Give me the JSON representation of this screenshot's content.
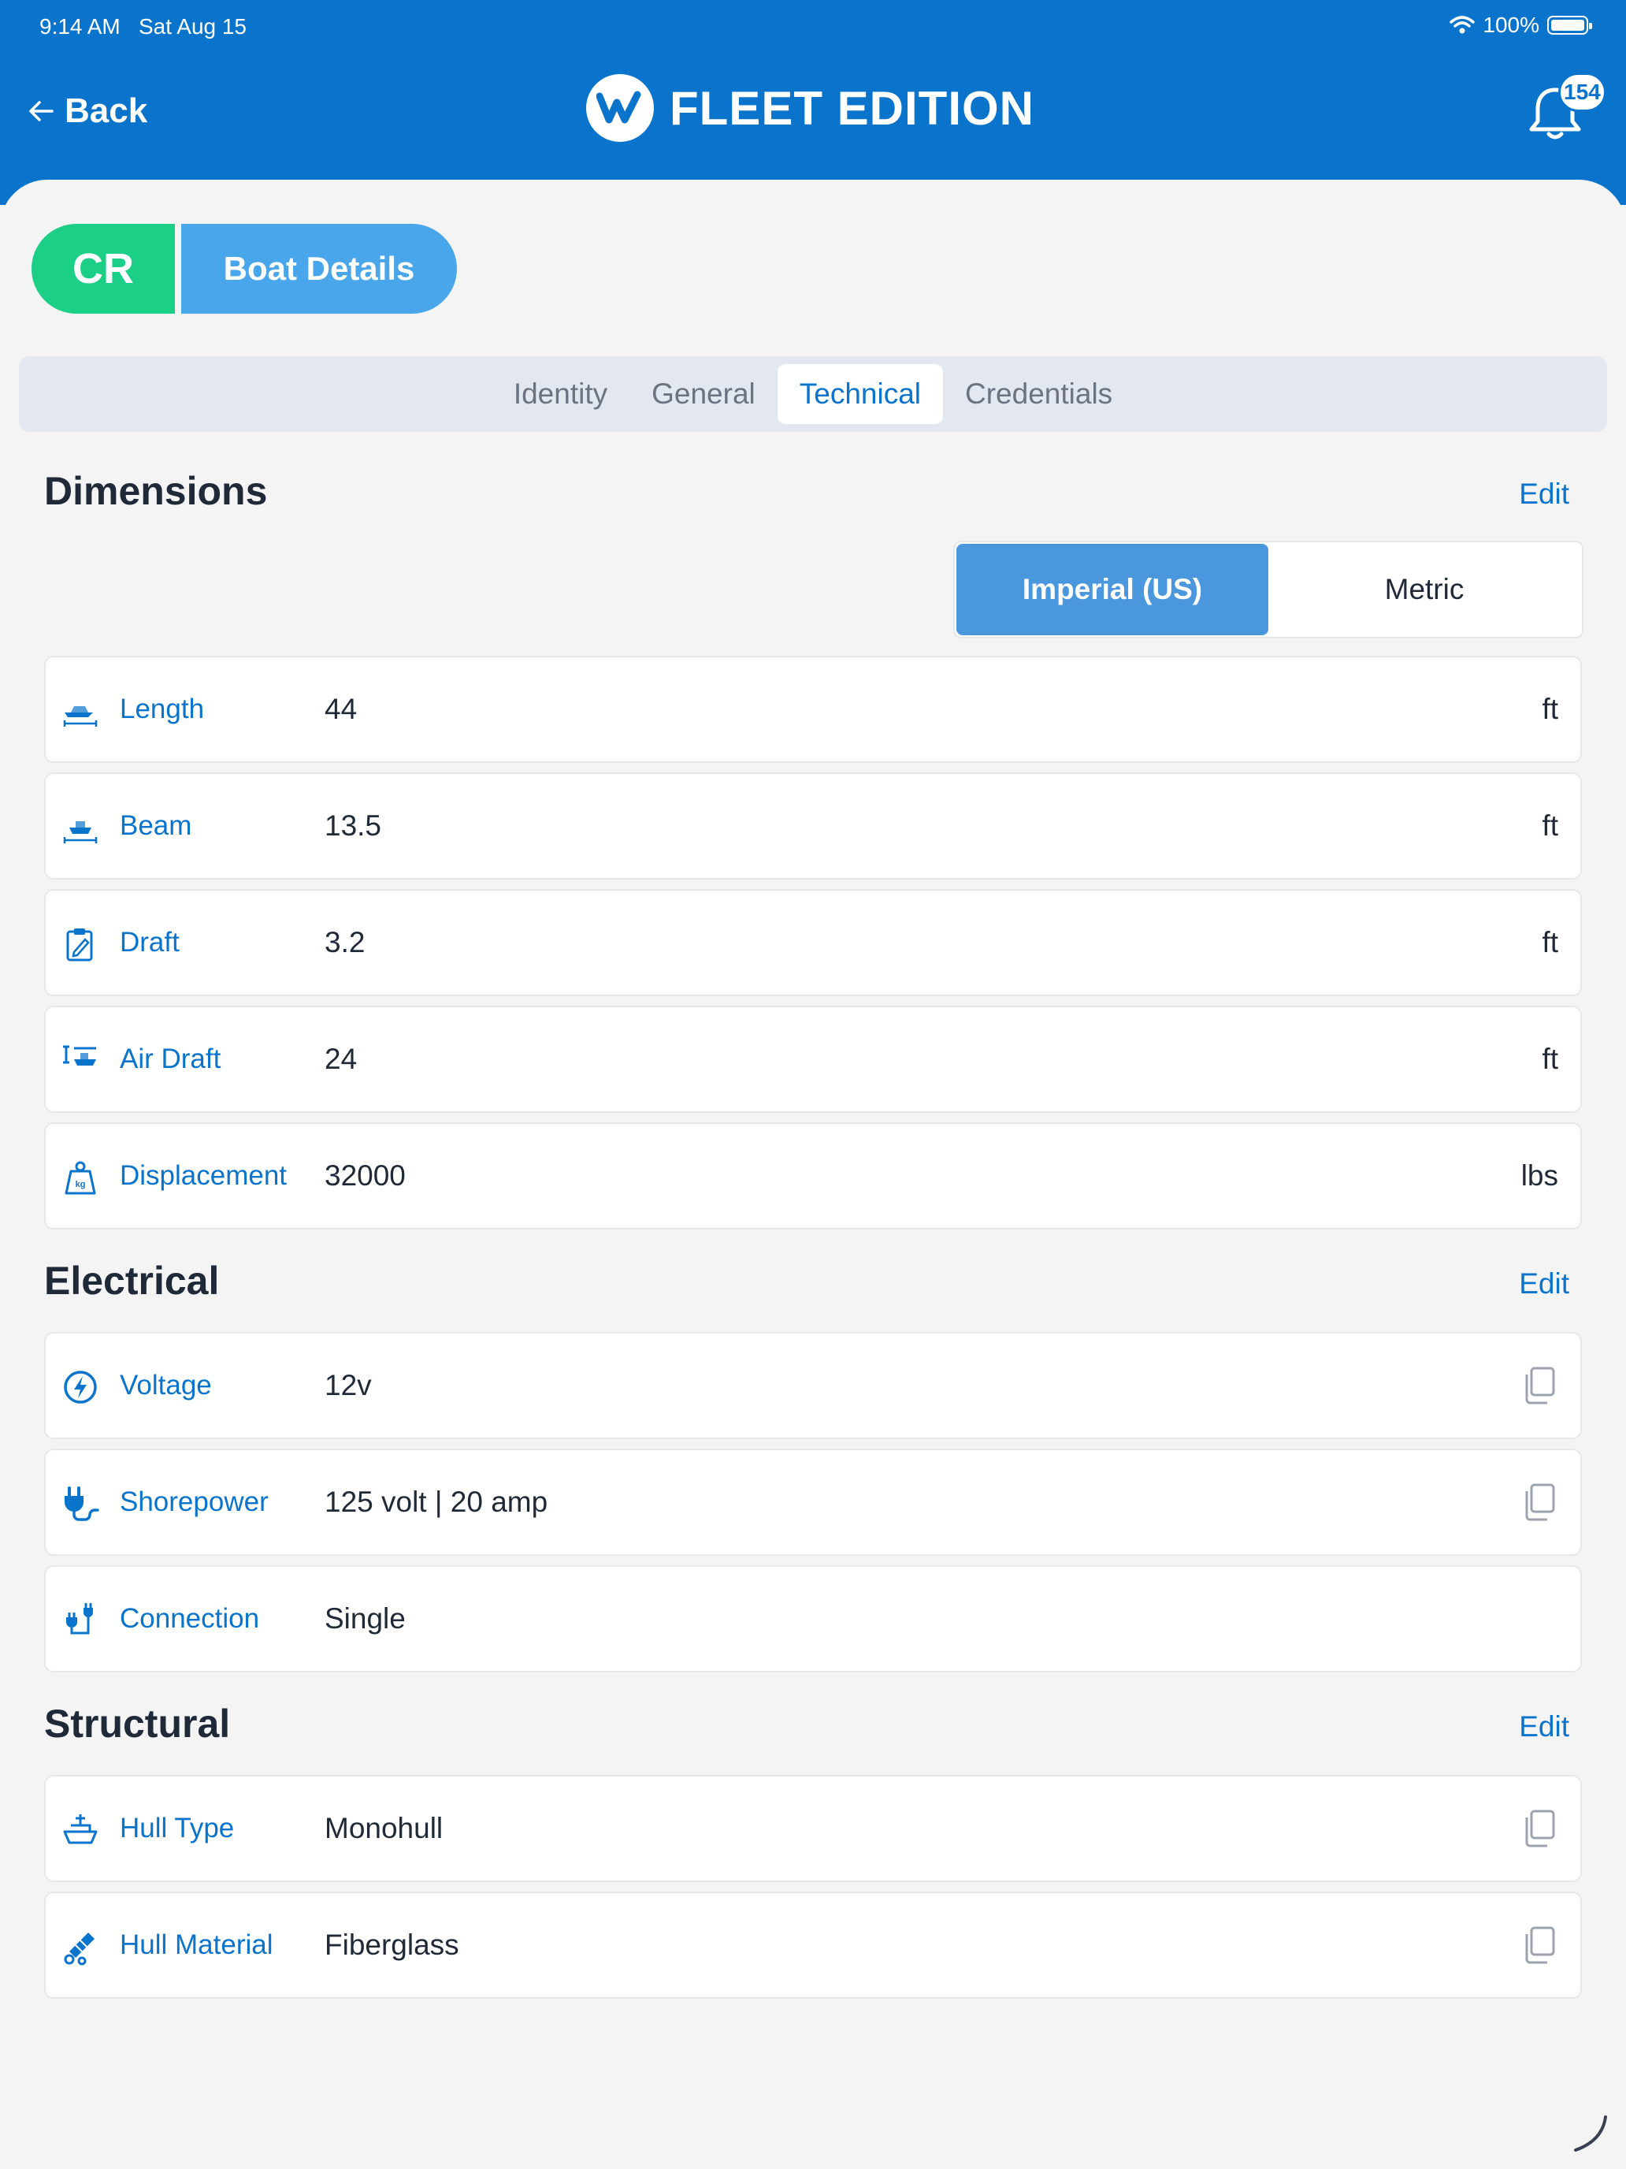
{
  "status": {
    "time": "9:14 AM",
    "date": "Sat Aug 15",
    "battery": "100%"
  },
  "header": {
    "back_label": "Back",
    "brand": "FLEET EDITION",
    "notification_count": "154"
  },
  "title_pill": {
    "initials": "CR",
    "title": "Boat Details"
  },
  "tabs": [
    {
      "label": "Identity",
      "active": false
    },
    {
      "label": "General",
      "active": false
    },
    {
      "label": "Technical",
      "active": true
    },
    {
      "label": "Credentials",
      "active": false
    }
  ],
  "dimensions": {
    "title": "Dimensions",
    "edit_label": "Edit",
    "units": {
      "imperial": "Imperial (US)",
      "metric": "Metric",
      "selected": "imperial"
    },
    "rows": [
      {
        "label": "Length",
        "value": "44",
        "unit": "ft",
        "icon": "boat-length-icon"
      },
      {
        "label": "Beam",
        "value": "13.5",
        "unit": "ft",
        "icon": "boat-beam-icon"
      },
      {
        "label": "Draft",
        "value": "3.2",
        "unit": "ft",
        "icon": "clipboard-pencil-icon"
      },
      {
        "label": "Air Draft",
        "value": "24",
        "unit": "ft",
        "icon": "air-draft-icon"
      },
      {
        "label": "Displacement",
        "value": "32000",
        "unit": "lbs",
        "icon": "kg-weight-icon"
      }
    ]
  },
  "electrical": {
    "title": "Electrical",
    "edit_label": "Edit",
    "rows": [
      {
        "label": "Voltage",
        "value": "12v",
        "icon": "bolt-circle-icon"
      },
      {
        "label": "Shorepower",
        "value": "125 volt | 20 amp",
        "icon": "plug-icon"
      },
      {
        "label": "Connection",
        "value": "Single",
        "icon": "plug-connection-icon"
      }
    ]
  },
  "structural": {
    "title": "Structural",
    "edit_label": "Edit",
    "rows": [
      {
        "label": "Hull Type",
        "value": "Monohull",
        "icon": "hull-icon"
      },
      {
        "label": "Hull Material",
        "value": "Fiberglass",
        "icon": "fiberglass-icon"
      }
    ]
  },
  "colors": {
    "header_blue": "#0a74cc",
    "accent_green": "#1ccf87",
    "pill_blue": "#4aa6ea",
    "toggle_blue": "#4a97dd"
  }
}
